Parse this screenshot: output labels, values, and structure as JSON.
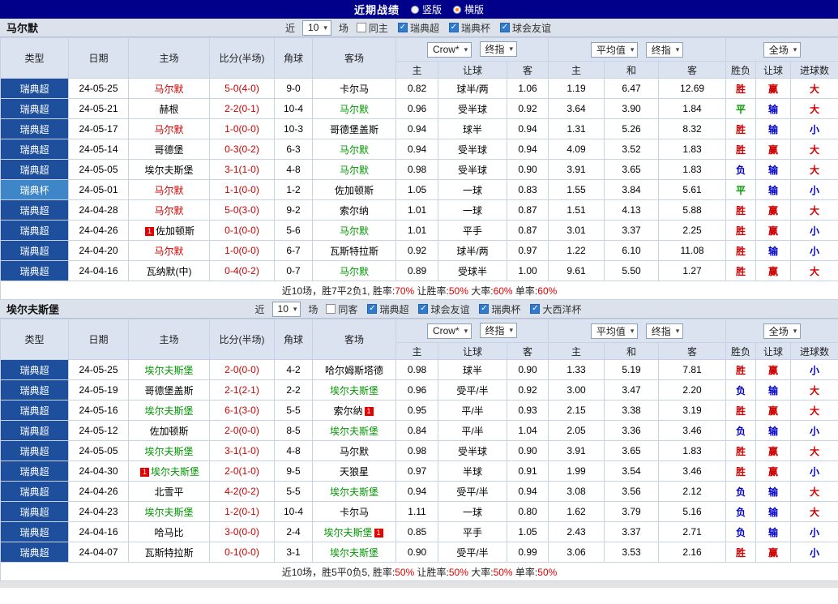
{
  "page": {
    "title": "近期战绩",
    "layout_options": [
      {
        "label": "竖版",
        "selected": false
      },
      {
        "label": "横版",
        "selected": true
      }
    ]
  },
  "colors": {
    "topbar_navy": "#00008b",
    "league_super": "#1d4f9c",
    "league_cup": "#3e86c7",
    "focus_home_red": "#cc0000",
    "focus_away_green": "#009900",
    "score_red": "#cc0000",
    "radio_selected_orange": "#ff8a00",
    "header_bg": "#dbe3f0"
  },
  "result_colors": {
    "胜": "#d10000",
    "平": "#009900",
    "负": "#0000cc",
    "赢": "#d10000",
    "输": "#0000cc",
    "大": "#d10000",
    "小": "#0000cc"
  },
  "sections": [
    {
      "team": "马尔默",
      "filters": {
        "near": "近",
        "count": "10",
        "games": "场",
        "same": {
          "label": "同主",
          "checked": false
        },
        "leagues": [
          {
            "label": "瑞典超",
            "checked": true
          },
          {
            "label": "瑞典杯",
            "checked": true
          },
          {
            "label": "球会友谊",
            "checked": true
          }
        ]
      },
      "dropdowns": {
        "asia": "Crow*",
        "asia_final": "终指",
        "euro": "平均值",
        "euro_final": "终指",
        "full": "全场"
      },
      "columns": {
        "type": "类型",
        "date": "日期",
        "home": "主场",
        "score": "比分(半场)",
        "corner": "角球",
        "away": "客场",
        "asia_home": "主",
        "asia_line": "让球",
        "asia_away": "客",
        "euro_home": "主",
        "euro_draw": "和",
        "euro_away": "客",
        "res_wdl": "胜负",
        "res_handicap": "让球",
        "res_goals": "进球数"
      },
      "rows": [
        {
          "league": "瑞典超",
          "is_cup": false,
          "date": "24-05-25",
          "home": "马尔默",
          "home_color": "red",
          "home_badge": "",
          "score": "5-0(4-0)",
          "corner": "9-0",
          "away": "卡尔马",
          "away_color": "",
          "away_badge": "",
          "asia_home": "0.82",
          "handicap": "球半/两",
          "asia_away": "1.06",
          "euro_home": "1.19",
          "euro_draw": "6.47",
          "euro_away": "12.69",
          "result": "胜",
          "handicap_result": "赢",
          "goals_result": "大"
        },
        {
          "league": "瑞典超",
          "is_cup": false,
          "date": "24-05-21",
          "home": "赫根",
          "home_color": "",
          "home_badge": "",
          "score": "2-2(0-1)",
          "corner": "10-4",
          "away": "马尔默",
          "away_color": "green",
          "away_badge": "",
          "asia_home": "0.96",
          "handicap": "受半球",
          "asia_away": "0.92",
          "euro_home": "3.64",
          "euro_draw": "3.90",
          "euro_away": "1.84",
          "result": "平",
          "handicap_result": "输",
          "goals_result": "大"
        },
        {
          "league": "瑞典超",
          "is_cup": false,
          "date": "24-05-17",
          "home": "马尔默",
          "home_color": "red",
          "home_badge": "",
          "score": "1-0(0-0)",
          "corner": "10-3",
          "away": "哥德堡盖斯",
          "away_color": "",
          "away_badge": "",
          "asia_home": "0.94",
          "handicap": "球半",
          "asia_away": "0.94",
          "euro_home": "1.31",
          "euro_draw": "5.26",
          "euro_away": "8.32",
          "result": "胜",
          "handicap_result": "输",
          "goals_result": "小"
        },
        {
          "league": "瑞典超",
          "is_cup": false,
          "date": "24-05-14",
          "home": "哥德堡",
          "home_color": "",
          "home_badge": "",
          "score": "0-3(0-2)",
          "corner": "6-3",
          "away": "马尔默",
          "away_color": "green",
          "away_badge": "",
          "asia_home": "0.94",
          "handicap": "受半球",
          "asia_away": "0.94",
          "euro_home": "4.09",
          "euro_draw": "3.52",
          "euro_away": "1.83",
          "result": "胜",
          "handicap_result": "赢",
          "goals_result": "大"
        },
        {
          "league": "瑞典超",
          "is_cup": false,
          "date": "24-05-05",
          "home": "埃尔夫斯堡",
          "home_color": "",
          "home_badge": "",
          "score": "3-1(1-0)",
          "corner": "4-8",
          "away": "马尔默",
          "away_color": "green",
          "away_badge": "",
          "asia_home": "0.98",
          "handicap": "受半球",
          "asia_away": "0.90",
          "euro_home": "3.91",
          "euro_draw": "3.65",
          "euro_away": "1.83",
          "result": "负",
          "handicap_result": "输",
          "goals_result": "大"
        },
        {
          "league": "瑞典杯",
          "is_cup": true,
          "date": "24-05-01",
          "home": "马尔默",
          "home_color": "red",
          "home_badge": "",
          "score": "1-1(0-0)",
          "corner": "1-2",
          "away": "佐加顿斯",
          "away_color": "",
          "away_badge": "",
          "asia_home": "1.05",
          "handicap": "一球",
          "asia_away": "0.83",
          "euro_home": "1.55",
          "euro_draw": "3.84",
          "euro_away": "5.61",
          "result": "平",
          "handicap_result": "输",
          "goals_result": "小"
        },
        {
          "league": "瑞典超",
          "is_cup": false,
          "date": "24-04-28",
          "home": "马尔默",
          "home_color": "red",
          "home_badge": "",
          "score": "5-0(3-0)",
          "corner": "9-2",
          "away": "索尔纳",
          "away_color": "",
          "away_badge": "",
          "asia_home": "1.01",
          "handicap": "一球",
          "asia_away": "0.87",
          "euro_home": "1.51",
          "euro_draw": "4.13",
          "euro_away": "5.88",
          "result": "胜",
          "handicap_result": "赢",
          "goals_result": "大"
        },
        {
          "league": "瑞典超",
          "is_cup": false,
          "date": "24-04-26",
          "home": "佐加顿斯",
          "home_color": "",
          "home_badge": "1",
          "score": "0-1(0-0)",
          "corner": "5-6",
          "away": "马尔默",
          "away_color": "green",
          "away_badge": "",
          "asia_home": "1.01",
          "handicap": "平手",
          "asia_away": "0.87",
          "euro_home": "3.01",
          "euro_draw": "3.37",
          "euro_away": "2.25",
          "result": "胜",
          "handicap_result": "赢",
          "goals_result": "小"
        },
        {
          "league": "瑞典超",
          "is_cup": false,
          "date": "24-04-20",
          "home": "马尔默",
          "home_color": "red",
          "home_badge": "",
          "score": "1-0(0-0)",
          "corner": "6-7",
          "away": "瓦斯特拉斯",
          "away_color": "",
          "away_badge": "",
          "asia_home": "0.92",
          "handicap": "球半/两",
          "asia_away": "0.97",
          "euro_home": "1.22",
          "euro_draw": "6.10",
          "euro_away": "11.08",
          "result": "胜",
          "handicap_result": "输",
          "goals_result": "小"
        },
        {
          "league": "瑞典超",
          "is_cup": false,
          "date": "24-04-16",
          "home": "瓦纳默(中)",
          "home_color": "",
          "home_badge": "",
          "score": "0-4(0-2)",
          "corner": "0-7",
          "away": "马尔默",
          "away_color": "green",
          "away_badge": "",
          "asia_home": "0.89",
          "handicap": "受球半",
          "asia_away": "1.00",
          "euro_home": "9.61",
          "euro_draw": "5.50",
          "euro_away": "1.27",
          "result": "胜",
          "handicap_result": "赢",
          "goals_result": "大"
        }
      ],
      "summary": [
        {
          "text": "近10场，胜7平2负1, ",
          "red": false
        },
        {
          "text": "胜率:",
          "red": false
        },
        {
          "text": "70%",
          "red": true
        },
        {
          "text": " 让胜率:",
          "red": false
        },
        {
          "text": "50%",
          "red": true
        },
        {
          "text": " 大率:",
          "red": false
        },
        {
          "text": "60%",
          "red": true
        },
        {
          "text": " 单率:",
          "red": false
        },
        {
          "text": "60%",
          "red": true
        }
      ]
    },
    {
      "team": "埃尔夫斯堡",
      "filters": {
        "near": "近",
        "count": "10",
        "games": "场",
        "same": {
          "label": "同客",
          "checked": false
        },
        "leagues": [
          {
            "label": "瑞典超",
            "checked": true
          },
          {
            "label": "球会友谊",
            "checked": true
          },
          {
            "label": "瑞典杯",
            "checked": true
          },
          {
            "label": "大西洋杯",
            "checked": true
          }
        ]
      },
      "dropdowns": {
        "asia": "Crow*",
        "asia_final": "终指",
        "euro": "平均值",
        "euro_final": "终指",
        "full": "全场"
      },
      "columns": {
        "type": "类型",
        "date": "日期",
        "home": "主场",
        "score": "比分(半场)",
        "corner": "角球",
        "away": "客场",
        "asia_home": "主",
        "asia_line": "让球",
        "asia_away": "客",
        "euro_home": "主",
        "euro_draw": "和",
        "euro_away": "客",
        "res_wdl": "胜负",
        "res_handicap": "让球",
        "res_goals": "进球数"
      },
      "rows": [
        {
          "league": "瑞典超",
          "is_cup": false,
          "date": "24-05-25",
          "home": "埃尔夫斯堡",
          "home_color": "green",
          "home_badge": "",
          "score": "2-0(0-0)",
          "corner": "4-2",
          "away": "哈尔姆斯塔德",
          "away_color": "",
          "away_badge": "",
          "asia_home": "0.98",
          "handicap": "球半",
          "asia_away": "0.90",
          "euro_home": "1.33",
          "euro_draw": "5.19",
          "euro_away": "7.81",
          "result": "胜",
          "handicap_result": "赢",
          "goals_result": "小"
        },
        {
          "league": "瑞典超",
          "is_cup": false,
          "date": "24-05-19",
          "home": "哥德堡盖斯",
          "home_color": "",
          "home_badge": "",
          "score": "2-1(2-1)",
          "corner": "2-2",
          "away": "埃尔夫斯堡",
          "away_color": "green",
          "away_badge": "",
          "asia_home": "0.96",
          "handicap": "受平/半",
          "asia_away": "0.92",
          "euro_home": "3.00",
          "euro_draw": "3.47",
          "euro_away": "2.20",
          "result": "负",
          "handicap_result": "输",
          "goals_result": "大"
        },
        {
          "league": "瑞典超",
          "is_cup": false,
          "date": "24-05-16",
          "home": "埃尔夫斯堡",
          "home_color": "green",
          "home_badge": "",
          "score": "6-1(3-0)",
          "corner": "5-5",
          "away": "索尔纳",
          "away_color": "",
          "away_badge": "1",
          "asia_home": "0.95",
          "handicap": "平/半",
          "asia_away": "0.93",
          "euro_home": "2.15",
          "euro_draw": "3.38",
          "euro_away": "3.19",
          "result": "胜",
          "handicap_result": "赢",
          "goals_result": "大"
        },
        {
          "league": "瑞典超",
          "is_cup": false,
          "date": "24-05-12",
          "home": "佐加顿斯",
          "home_color": "",
          "home_badge": "",
          "score": "2-0(0-0)",
          "corner": "8-5",
          "away": "埃尔夫斯堡",
          "away_color": "green",
          "away_badge": "",
          "asia_home": "0.84",
          "handicap": "平/半",
          "asia_away": "1.04",
          "euro_home": "2.05",
          "euro_draw": "3.36",
          "euro_away": "3.46",
          "result": "负",
          "handicap_result": "输",
          "goals_result": "小"
        },
        {
          "league": "瑞典超",
          "is_cup": false,
          "date": "24-05-05",
          "home": "埃尔夫斯堡",
          "home_color": "green",
          "home_badge": "",
          "score": "3-1(1-0)",
          "corner": "4-8",
          "away": "马尔默",
          "away_color": "",
          "away_badge": "",
          "asia_home": "0.98",
          "handicap": "受半球",
          "asia_away": "0.90",
          "euro_home": "3.91",
          "euro_draw": "3.65",
          "euro_away": "1.83",
          "result": "胜",
          "handicap_result": "赢",
          "goals_result": "大"
        },
        {
          "league": "瑞典超",
          "is_cup": false,
          "date": "24-04-30",
          "home": "埃尔夫斯堡",
          "home_color": "green",
          "home_badge": "1",
          "score": "2-0(1-0)",
          "corner": "9-5",
          "away": "天狼星",
          "away_color": "",
          "away_badge": "",
          "asia_home": "0.97",
          "handicap": "半球",
          "asia_away": "0.91",
          "euro_home": "1.99",
          "euro_draw": "3.54",
          "euro_away": "3.46",
          "result": "胜",
          "handicap_result": "赢",
          "goals_result": "小"
        },
        {
          "league": "瑞典超",
          "is_cup": false,
          "date": "24-04-26",
          "home": "北雪平",
          "home_color": "",
          "home_badge": "",
          "score": "4-2(0-2)",
          "corner": "5-5",
          "away": "埃尔夫斯堡",
          "away_color": "green",
          "away_badge": "",
          "asia_home": "0.94",
          "handicap": "受平/半",
          "asia_away": "0.94",
          "euro_home": "3.08",
          "euro_draw": "3.56",
          "euro_away": "2.12",
          "result": "负",
          "handicap_result": "输",
          "goals_result": "大"
        },
        {
          "league": "瑞典超",
          "is_cup": false,
          "date": "24-04-23",
          "home": "埃尔夫斯堡",
          "home_color": "green",
          "home_badge": "",
          "score": "1-2(0-1)",
          "corner": "10-4",
          "away": "卡尔马",
          "away_color": "",
          "away_badge": "",
          "asia_home": "1.11",
          "handicap": "一球",
          "asia_away": "0.80",
          "euro_home": "1.62",
          "euro_draw": "3.79",
          "euro_away": "5.16",
          "result": "负",
          "handicap_result": "输",
          "goals_result": "大"
        },
        {
          "league": "瑞典超",
          "is_cup": false,
          "date": "24-04-16",
          "home": "哈马比",
          "home_color": "",
          "home_badge": "",
          "score": "3-0(0-0)",
          "corner": "2-4",
          "away": "埃尔夫斯堡",
          "away_color": "green",
          "away_badge": "1",
          "asia_home": "0.85",
          "handicap": "平手",
          "asia_away": "1.05",
          "euro_home": "2.43",
          "euro_draw": "3.37",
          "euro_away": "2.71",
          "result": "负",
          "handicap_result": "输",
          "goals_result": "小"
        },
        {
          "league": "瑞典超",
          "is_cup": false,
          "date": "24-04-07",
          "home": "瓦斯特拉斯",
          "home_color": "",
          "home_badge": "",
          "score": "0-1(0-0)",
          "corner": "3-1",
          "away": "埃尔夫斯堡",
          "away_color": "green",
          "away_badge": "",
          "asia_home": "0.90",
          "handicap": "受平/半",
          "asia_away": "0.99",
          "euro_home": "3.06",
          "euro_draw": "3.53",
          "euro_away": "2.16",
          "result": "胜",
          "handicap_result": "赢",
          "goals_result": "小"
        }
      ],
      "summary": [
        {
          "text": "近10场，胜5平0负5, ",
          "red": false
        },
        {
          "text": "胜率:",
          "red": false
        },
        {
          "text": "50%",
          "red": true
        },
        {
          "text": " 让胜率:",
          "red": false
        },
        {
          "text": "50%",
          "red": true
        },
        {
          "text": " 大率:",
          "red": false
        },
        {
          "text": "50%",
          "red": true
        },
        {
          "text": " 单率:",
          "red": false
        },
        {
          "text": "50%",
          "red": true
        }
      ]
    }
  ]
}
